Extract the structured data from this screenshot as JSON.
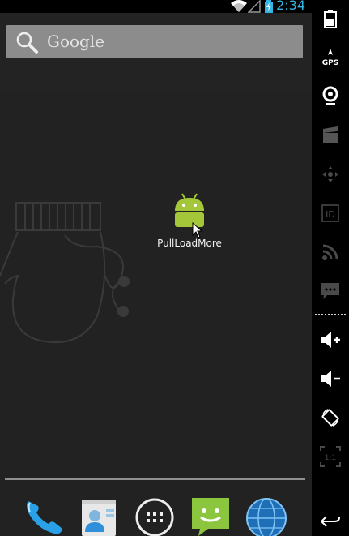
{
  "status_bar": {
    "time": "2:34",
    "icons": [
      "wifi-icon",
      "signal-icon",
      "battery-charging-icon"
    ],
    "time_color": "#33b5e5"
  },
  "search": {
    "label": "Google",
    "icon": "search-icon"
  },
  "workspace": {
    "shortcuts": [
      {
        "label": "PullLoadMore",
        "icon": "android-app-icon"
      }
    ]
  },
  "dock": {
    "items": [
      {
        "name": "phone",
        "icon": "phone-icon"
      },
      {
        "name": "contacts",
        "icon": "contacts-icon"
      },
      {
        "name": "all-apps",
        "icon": "app-drawer-icon"
      },
      {
        "name": "messaging",
        "icon": "messaging-icon"
      },
      {
        "name": "browser",
        "icon": "globe-icon"
      }
    ]
  },
  "side_panel": {
    "items": [
      {
        "name": "battery",
        "icon": "battery-icon"
      },
      {
        "name": "gps",
        "icon": "gps-icon",
        "label": "GPS"
      },
      {
        "name": "camera",
        "icon": "webcam-icon"
      },
      {
        "name": "media",
        "icon": "clapperboard-icon"
      },
      {
        "name": "dpad",
        "icon": "dpad-icon"
      },
      {
        "name": "device-id",
        "icon": "id-icon",
        "label": "ID"
      },
      {
        "name": "network",
        "icon": "rss-icon"
      },
      {
        "name": "sms",
        "icon": "sms-icon"
      },
      {
        "name": "volume-up",
        "icon": "volume-up-icon"
      },
      {
        "name": "volume-down",
        "icon": "volume-down-icon"
      },
      {
        "name": "rotate",
        "icon": "rotate-icon"
      },
      {
        "name": "scale",
        "icon": "scale-icon",
        "label": "1:1"
      },
      {
        "name": "back",
        "icon": "back-icon"
      }
    ]
  },
  "colors": {
    "android_green": "#a4c639",
    "accent_blue": "#33b5e5",
    "panel_icon": "#d0d0d0"
  }
}
